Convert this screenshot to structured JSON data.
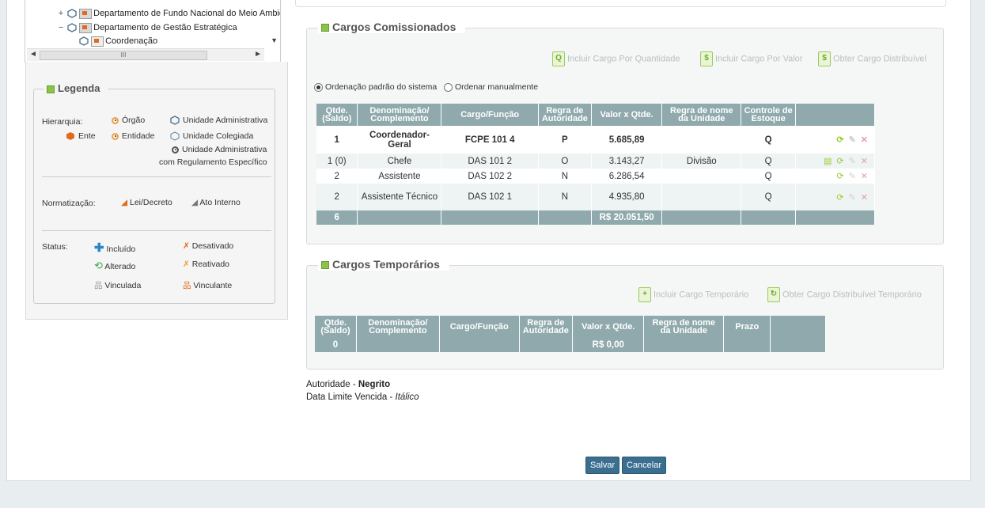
{
  "tree": {
    "items": [
      {
        "label": "Departamento de Fundo Nacional do Meio Ambie",
        "expander": "+"
      },
      {
        "label": "Departamento de Gestão Estratégica",
        "expander": "−"
      },
      {
        "label": "Coordenação",
        "expander": ""
      }
    ],
    "scroll_mark": "III"
  },
  "legend": {
    "title": "Legenda",
    "hierarquia_label": "Hierarquia:",
    "orgao": "Órgão",
    "unidade_adm": "Unidade Administrativa",
    "ente": "Ente",
    "entidade": "Entidade",
    "unidade_colegiada": "Unidade Colegiada",
    "unidade_adm_reg_1": "Unidade Administrativa",
    "unidade_adm_reg_2": "com Regulamento Específico",
    "normatizacao_label": "Normatização:",
    "lei_decreto": "Lei/Decreto",
    "ato_interno": "Ato Interno",
    "status_label": "Status:",
    "incluido": "Incluído",
    "desativado": "Desativado",
    "alterado": "Alterado",
    "reativado": "Reativado",
    "vinculada": "Vinculada",
    "vinculante": "Vinculante"
  },
  "comissionados": {
    "title": "Cargos Comissionados",
    "actions": [
      "Incluir Cargo Por Quantidade",
      "Incluir Cargo Por Valor",
      "Obter Cargo Distribuível"
    ],
    "order_default": "Ordenação padrão do sistema",
    "order_manual": "Ordenar manualmente",
    "headers": [
      "Qtde. (Saldo)",
      "Denominação/ Complemento",
      "Cargo/Função",
      "Regra de Autoridade",
      "Valor x Qtde.",
      "Regra de nome da Unidade",
      "Controle de Estoque"
    ],
    "rows": [
      {
        "qtde": "1",
        "denominacao": "Coordenador-Geral",
        "cargo": "FCPE 101 4",
        "regra": "P",
        "valor": "5.685,89",
        "regra_nome": "",
        "controle": "Q",
        "bold": true
      },
      {
        "qtde": "1 (0)",
        "denominacao": "Chefe",
        "cargo": "DAS 101 2",
        "regra": "O",
        "valor": "3.143,27",
        "regra_nome": "Divisão",
        "controle": "Q",
        "bold": false
      },
      {
        "qtde": "2",
        "denominacao": "Assistente",
        "cargo": "DAS 102 2",
        "regra": "N",
        "valor": "6.286,54",
        "regra_nome": "",
        "controle": "Q",
        "bold": false
      },
      {
        "qtde": "2",
        "denominacao": "Assistente Técnico",
        "cargo": "DAS 102 1",
        "regra": "N",
        "valor": "4.935,80",
        "regra_nome": "",
        "controle": "Q",
        "bold": false
      }
    ],
    "total_qtde": "6",
    "total_valor": "R$ 20.051,50"
  },
  "temporarios": {
    "title": "Cargos Temporários",
    "actions": [
      "Incluir Cargo Temporário",
      "Obter Cargo Distribuível Temporário"
    ],
    "headers": [
      "Qtde. (Saldo)",
      "Denominação/ Complemento",
      "Cargo/Função",
      "Regra de Autoridade",
      "Valor x Qtde.",
      "Regra de nome da Unidade",
      "Prazo"
    ],
    "total_qtde": "0",
    "total_valor": "R$ 0,00"
  },
  "notes": {
    "autoridade_label": "Autoridade - ",
    "autoridade_value": "Negrito",
    "data_label": "Data Limite Vencida - ",
    "data_value": "Itálico"
  },
  "buttons": {
    "save": "Salvar",
    "cancel": "Cancelar"
  },
  "colors": {
    "header": "#8fa9ad",
    "accent": "#8bc34a",
    "button": "#3a6f8f"
  }
}
